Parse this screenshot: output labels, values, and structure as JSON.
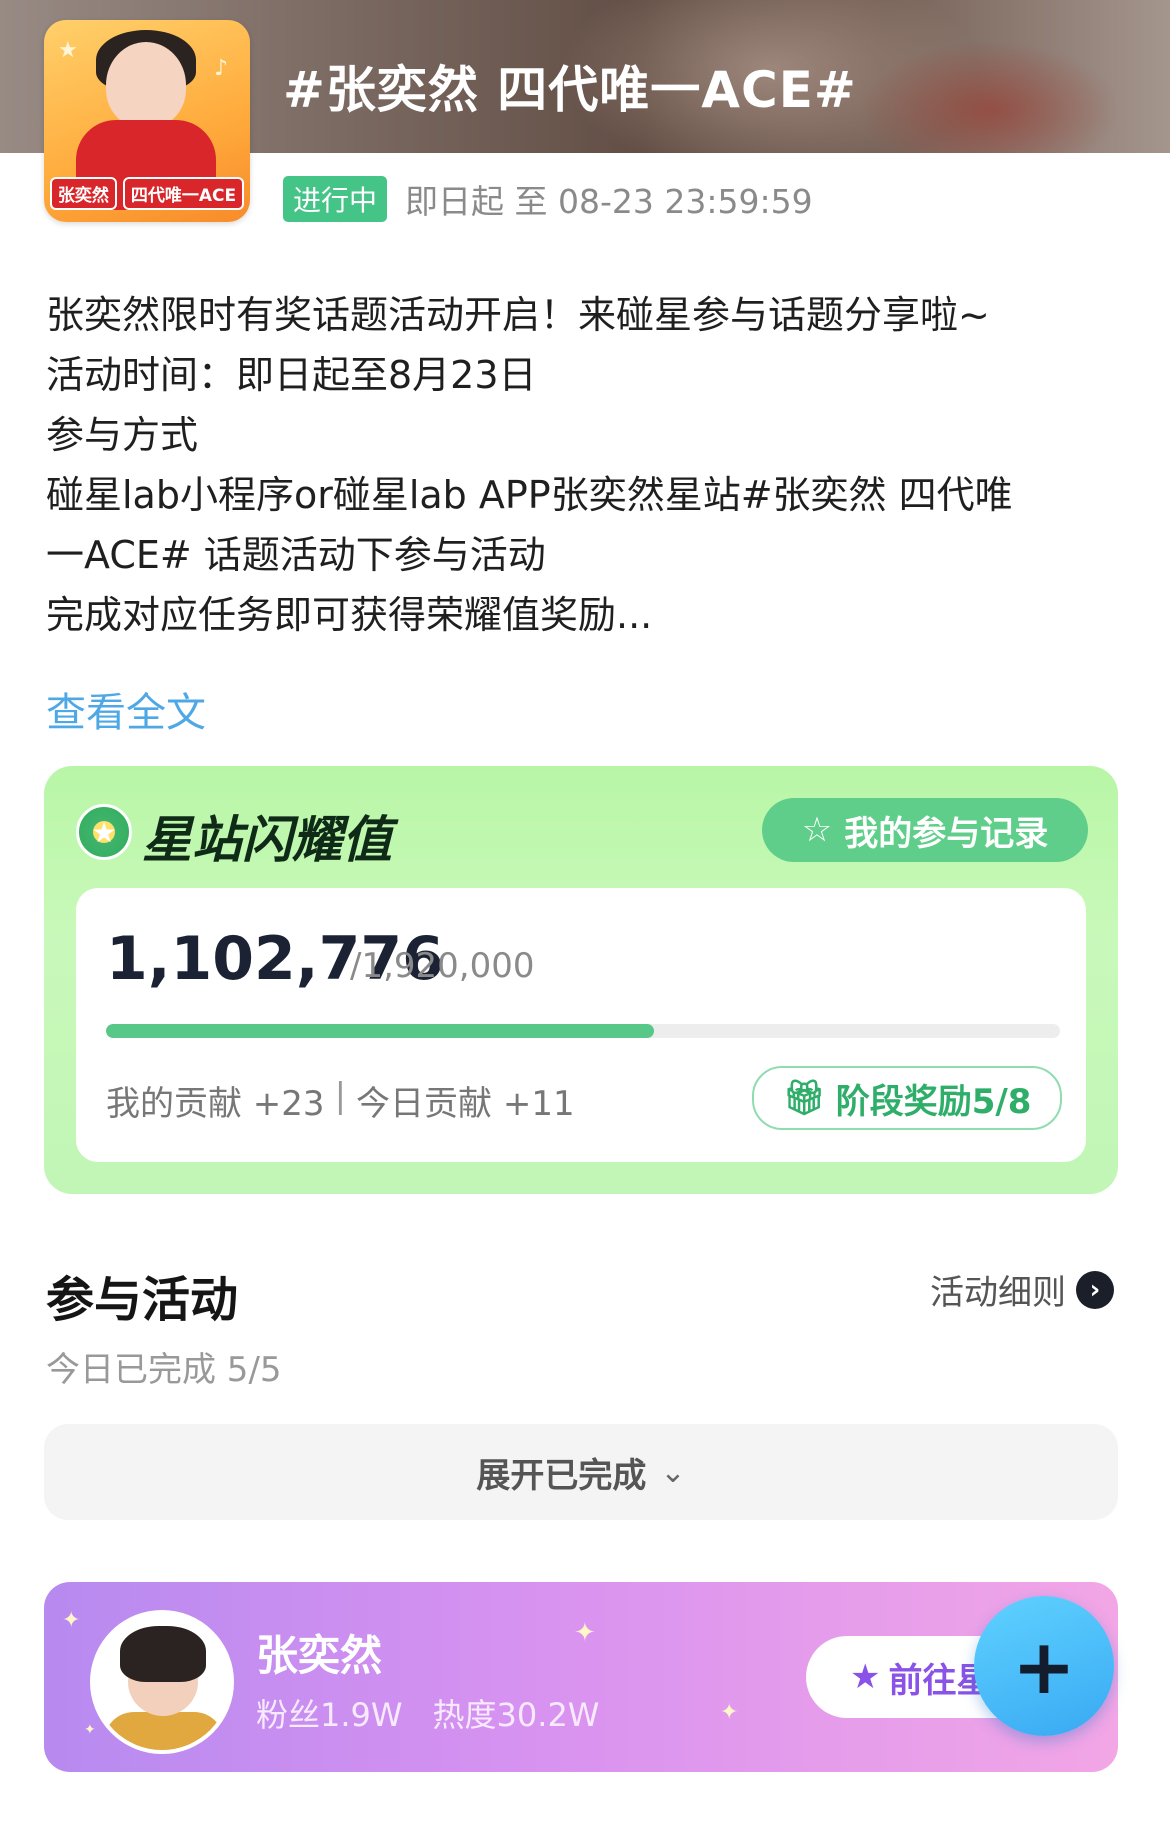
{
  "header": {
    "title": "#张奕然 四代唯一ACE#",
    "cover_caption": [
      "张奕然",
      "四代唯一ACE"
    ],
    "status_badge": "进行中",
    "time_range": "即日起 至 08-23 23:59:59"
  },
  "description": {
    "lines": [
      "张奕然限时有奖话题活动开启！来碰星参与话题分享啦~",
      "活动时间：即日起至8月23日",
      "参与方式",
      "碰星lab小程序or碰星lab APP张奕然星站#张奕然 四代唯",
      "一ACE# 话题活动下参与活动",
      "完成对应任务即可获得荣耀值奖励..."
    ],
    "read_more": "查看全文"
  },
  "glory": {
    "title": "星站闪耀值",
    "record_button": "我的参与记录",
    "current": "1,102,776",
    "total": "/1,920,000",
    "progress_fraction": 0.574,
    "my_contribution": "我的贡献 +23",
    "separator": "|",
    "today_contribution": "今日贡献 +11",
    "stage_reward": "阶段奖励5/8",
    "accent_color": "#57c887"
  },
  "activities": {
    "title": "参与活动",
    "rules_link": "活动细则",
    "done_today": "今日已完成 5/5",
    "expand_label": "展开已完成"
  },
  "star": {
    "name": "张奕然",
    "fans": "粉丝1.9W",
    "heat": "热度30.2W",
    "goto_button": "前往星"
  },
  "fab": {
    "label": "+"
  }
}
